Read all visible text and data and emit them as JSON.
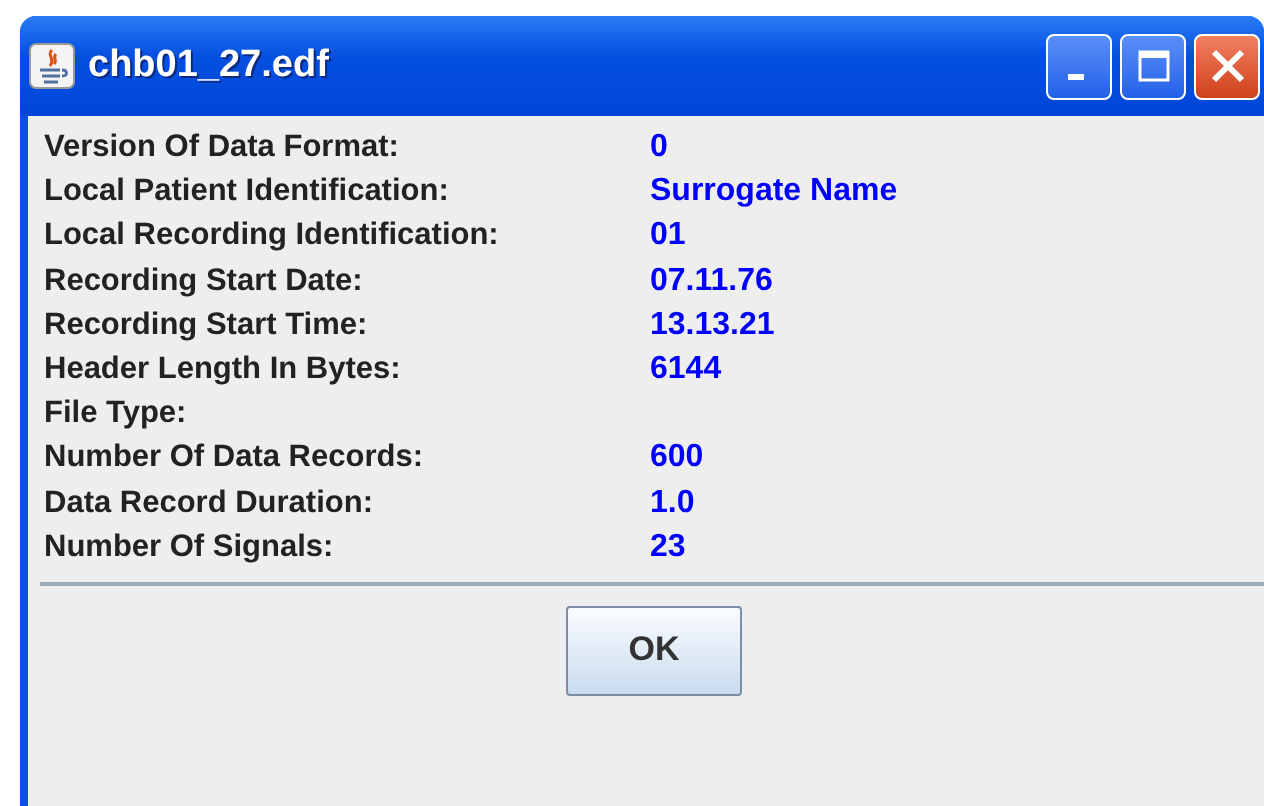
{
  "window": {
    "title": "chb01_27.edf"
  },
  "fields": [
    {
      "label": "Version Of Data Format:",
      "value": "0"
    },
    {
      "label": "Local Patient Identification:",
      "value": "Surrogate Name"
    },
    {
      "label": "Local Recording Identification:",
      "value": "01"
    },
    {
      "label": "Recording Start Date:",
      "value": "07.11.76"
    },
    {
      "label": "Recording Start Time:",
      "value": "13.13.21"
    },
    {
      "label": "Header Length In Bytes:",
      "value": "6144"
    },
    {
      "label": "File Type:"
    },
    {
      "label": "Number Of Data Records:",
      "value": "600"
    },
    {
      "label": "Data Record Duration:",
      "value": "1.0"
    },
    {
      "label": "Number Of Signals:",
      "value": "23"
    }
  ],
  "buttons": [
    "OK"
  ]
}
